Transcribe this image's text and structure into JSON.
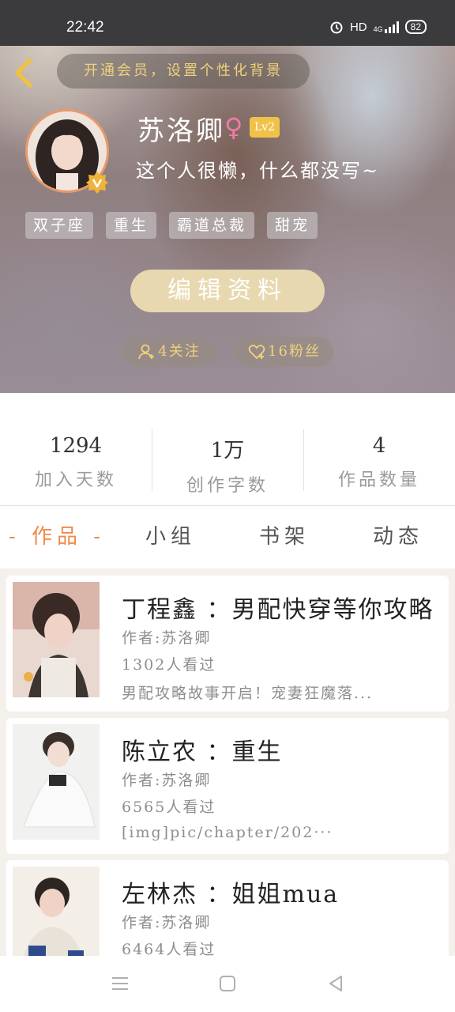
{
  "status_bar": {
    "time": "22:42",
    "network": "HD",
    "signal": "4G",
    "battery": "82"
  },
  "header": {
    "vip_banner": "开通会员，设置个性化背景",
    "username": "苏洛卿",
    "gender_symbol": "♀",
    "level": "Lv2",
    "bio": "这个人很懒，什么都没写~",
    "tags": [
      "双子座",
      "重生",
      "霸道总裁",
      "甜宠"
    ],
    "edit_button": "编辑资料",
    "following": "4关注",
    "followers": "16粉丝"
  },
  "stats": [
    {
      "value": "1294",
      "label": "加入天数"
    },
    {
      "value": "1万",
      "label": "创作字数"
    },
    {
      "value": "4",
      "label": "作品数量"
    }
  ],
  "tabs": [
    "- 作品 -",
    "小组",
    "书架",
    "动态"
  ],
  "works": [
    {
      "title": "丁程鑫 ：男配快穿等你攻略",
      "author": "作者:苏洛卿",
      "views": "1302人看过",
      "desc": "男配攻略故事开启！宠妻狂魔落..."
    },
    {
      "title": "陈立农 ：重生",
      "author": "作者:苏洛卿",
      "views": "6565人看过",
      "desc": "[img]pic/chapter/202···"
    },
    {
      "title": "左林杰 ：姐姐mua",
      "author": "作者:苏洛卿",
      "views": "6464人看过",
      "desc": ""
    }
  ],
  "colors": {
    "accent": "#f08a4b",
    "gold": "#f0d27a",
    "edit_button": "#e8d8b0",
    "level_badge": "#f0c24a"
  }
}
